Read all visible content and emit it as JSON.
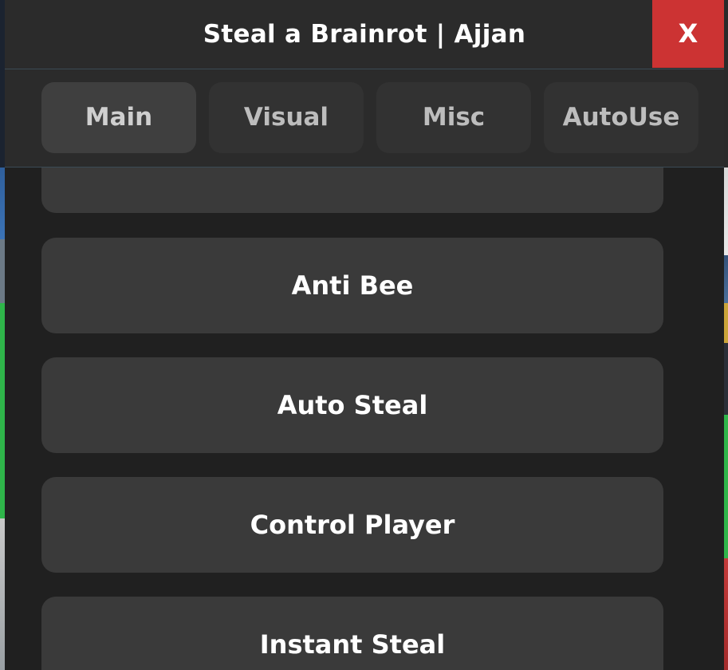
{
  "window": {
    "title": "Steal a Brainrot | Ajjan",
    "close_label": "X"
  },
  "tabs": [
    {
      "label": "Main",
      "active": true
    },
    {
      "label": "Visual",
      "active": false
    },
    {
      "label": "Misc",
      "active": false
    },
    {
      "label": "AutoUse",
      "active": false
    }
  ],
  "features": [
    {
      "label": ""
    },
    {
      "label": "Anti Bee"
    },
    {
      "label": "Auto Steal"
    },
    {
      "label": "Control Player"
    },
    {
      "label": "Instant Steal"
    }
  ],
  "colors": {
    "panel": "#2b2b2b",
    "content": "#202020",
    "button": "#3a3a3a",
    "active_tab": "#3f3f3f",
    "close": "#cc3333"
  }
}
